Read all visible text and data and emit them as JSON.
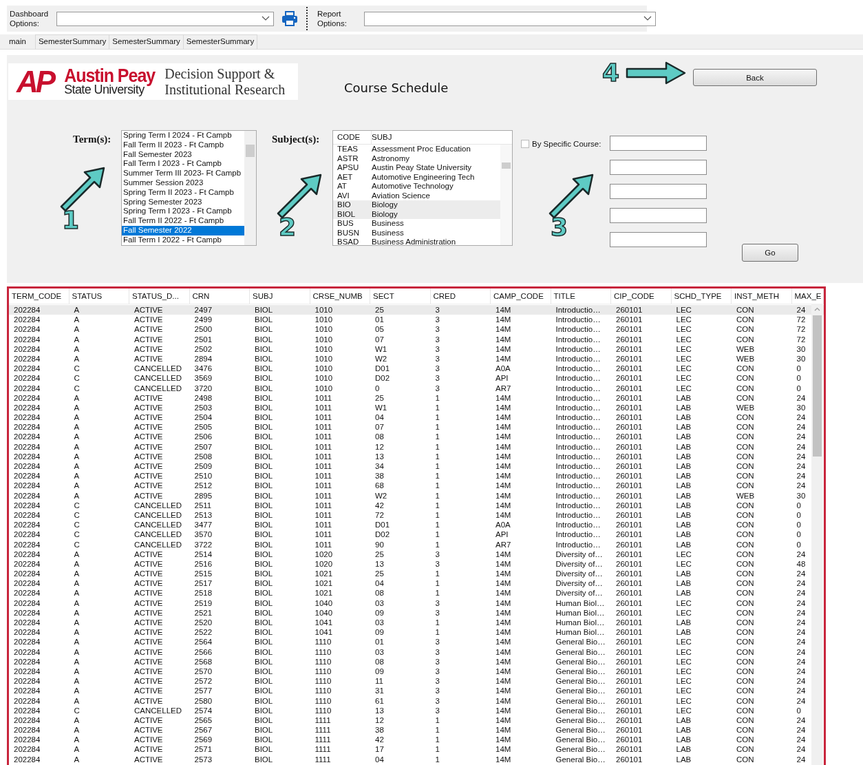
{
  "toolbar": {
    "dashboard_label": "Dashboard Options:",
    "report_label": "Report Options:"
  },
  "tabs": [
    {
      "label": "main",
      "selected": true
    },
    {
      "label": "SemesterSummary",
      "selected": false
    },
    {
      "label": "SemesterSummary",
      "selected": false
    },
    {
      "label": "SemesterSummary",
      "selected": false
    }
  ],
  "logo": {
    "monogram": "AP",
    "name_lines": [
      "Austin Peay",
      "State University"
    ],
    "department_lines": [
      "Decision Support &",
      "Institutional Research"
    ]
  },
  "title": "Course Schedule",
  "back_button": "Back",
  "terms": {
    "label": "Term(s):",
    "items": [
      {
        "text": "Spring Term I 2024 - Ft Campb",
        "selected": false
      },
      {
        "text": "Fall Term II 2023 - Ft Campb",
        "selected": false
      },
      {
        "text": "Fall Semester 2023",
        "selected": false
      },
      {
        "text": "Fall Term I 2023 - Ft Campb",
        "selected": false
      },
      {
        "text": "Summer Term III 2023- Ft Campb",
        "selected": false
      },
      {
        "text": "Summer Session 2023",
        "selected": false
      },
      {
        "text": "Spring Term II 2023 - Ft Campb",
        "selected": false
      },
      {
        "text": "Spring Semester 2023",
        "selected": false
      },
      {
        "text": "Spring Term I 2023 - Ft Campb",
        "selected": false
      },
      {
        "text": "Fall Term II 2022 - Ft Campb",
        "selected": false
      },
      {
        "text": "Fall Semester 2022",
        "selected": true
      },
      {
        "text": "Fall Term I 2022 - Ft Campb",
        "selected": false
      }
    ]
  },
  "subjects": {
    "label": "Subject(s):",
    "columns": [
      "CODE",
      "SUBJ"
    ],
    "items": [
      {
        "code": "TEAS",
        "subj": "Assessment Proc Education",
        "selected": false
      },
      {
        "code": "ASTR",
        "subj": "Astronomy",
        "selected": false
      },
      {
        "code": "APSU",
        "subj": "Austin Peay State University",
        "selected": false
      },
      {
        "code": "AET",
        "subj": "Automotive Engineering Tech",
        "selected": false
      },
      {
        "code": "AT",
        "subj": "Automotive Technology",
        "selected": false
      },
      {
        "code": "AVI",
        "subj": "Aviation Science",
        "selected": false
      },
      {
        "code": "BIO",
        "subj": "Biology",
        "selected": true
      },
      {
        "code": "BIOL",
        "subj": "Biology",
        "selected": true
      },
      {
        "code": "BUS",
        "subj": "Business",
        "selected": false
      },
      {
        "code": "BUSN",
        "subj": "Business",
        "selected": false
      },
      {
        "code": "BSAD",
        "subj": "Business Administration",
        "selected": false
      }
    ]
  },
  "specific_course": {
    "label": "By Specific Course:",
    "checked": false
  },
  "go_button": "Go",
  "annotations": [
    {
      "label": "1",
      "kind": "diagonal"
    },
    {
      "label": "2",
      "kind": "diagonal"
    },
    {
      "label": "3",
      "kind": "diagonal"
    },
    {
      "label": "4",
      "kind": "horizontal"
    }
  ],
  "table": {
    "columns": [
      "TERM_CODE",
      "STATUS",
      "STATUS_D...",
      "CRN",
      "SUBJ",
      "CRSE_NUMB",
      "SECT",
      "CRED",
      "CAMP_CODE",
      "TITLE",
      "CIP_CODE",
      "SCHD_TYPE",
      "INST_METH",
      "MAX_E"
    ],
    "rows": [
      {
        "selected": true,
        "cells": [
          "202284",
          "A",
          "ACTIVE",
          "2497",
          "BIOL",
          "1010",
          "25",
          "3",
          "14M",
          "Introductio…",
          "260101",
          "LEC",
          "CON",
          "24"
        ]
      },
      {
        "selected": false,
        "cells": [
          "202284",
          "A",
          "ACTIVE",
          "2499",
          "BIOL",
          "1010",
          "01",
          "3",
          "14M",
          "Introductio…",
          "260101",
          "LEC",
          "CON",
          "72"
        ]
      },
      {
        "selected": false,
        "cells": [
          "202284",
          "A",
          "ACTIVE",
          "2500",
          "BIOL",
          "1010",
          "05",
          "3",
          "14M",
          "Introductio…",
          "260101",
          "LEC",
          "CON",
          "72"
        ]
      },
      {
        "selected": false,
        "cells": [
          "202284",
          "A",
          "ACTIVE",
          "2501",
          "BIOL",
          "1010",
          "07",
          "3",
          "14M",
          "Introductio…",
          "260101",
          "LEC",
          "CON",
          "72"
        ]
      },
      {
        "selected": false,
        "cells": [
          "202284",
          "A",
          "ACTIVE",
          "2502",
          "BIOL",
          "1010",
          "W1",
          "3",
          "14M",
          "Introductio…",
          "260101",
          "LEC",
          "WEB",
          "30"
        ]
      },
      {
        "selected": false,
        "cells": [
          "202284",
          "A",
          "ACTIVE",
          "2894",
          "BIOL",
          "1010",
          "W2",
          "3",
          "14M",
          "Introductio…",
          "260101",
          "LEC",
          "WEB",
          "30"
        ]
      },
      {
        "selected": false,
        "cells": [
          "202284",
          "C",
          "CANCELLED",
          "3476",
          "BIOL",
          "1010",
          "D01",
          "3",
          "A0A",
          "Introductio…",
          "260101",
          "LEC",
          "CON",
          "0"
        ]
      },
      {
        "selected": false,
        "cells": [
          "202284",
          "C",
          "CANCELLED",
          "3569",
          "BIOL",
          "1010",
          "D02",
          "3",
          "API",
          "Introductio…",
          "260101",
          "LEC",
          "CON",
          "0"
        ]
      },
      {
        "selected": false,
        "cells": [
          "202284",
          "C",
          "CANCELLED",
          "3720",
          "BIOL",
          "1010",
          "0",
          "3",
          "AR7",
          "Introductio…",
          "260101",
          "LEC",
          "CON",
          "0"
        ]
      },
      {
        "selected": false,
        "cells": [
          "202284",
          "A",
          "ACTIVE",
          "2498",
          "BIOL",
          "1011",
          "25",
          "1",
          "14M",
          "Introductio…",
          "260101",
          "LAB",
          "CON",
          "24"
        ]
      },
      {
        "selected": false,
        "cells": [
          "202284",
          "A",
          "ACTIVE",
          "2503",
          "BIOL",
          "1011",
          "W1",
          "1",
          "14M",
          "Introductio…",
          "260101",
          "LAB",
          "WEB",
          "30"
        ]
      },
      {
        "selected": false,
        "cells": [
          "202284",
          "A",
          "ACTIVE",
          "2504",
          "BIOL",
          "1011",
          "04",
          "1",
          "14M",
          "Introductio…",
          "260101",
          "LAB",
          "CON",
          "24"
        ]
      },
      {
        "selected": false,
        "cells": [
          "202284",
          "A",
          "ACTIVE",
          "2505",
          "BIOL",
          "1011",
          "07",
          "1",
          "14M",
          "Introductio…",
          "260101",
          "LAB",
          "CON",
          "24"
        ]
      },
      {
        "selected": false,
        "cells": [
          "202284",
          "A",
          "ACTIVE",
          "2506",
          "BIOL",
          "1011",
          "08",
          "1",
          "14M",
          "Introductio…",
          "260101",
          "LAB",
          "CON",
          "24"
        ]
      },
      {
        "selected": false,
        "cells": [
          "202284",
          "A",
          "ACTIVE",
          "2507",
          "BIOL",
          "1011",
          "12",
          "1",
          "14M",
          "Introductio…",
          "260101",
          "LAB",
          "CON",
          "24"
        ]
      },
      {
        "selected": false,
        "cells": [
          "202284",
          "A",
          "ACTIVE",
          "2508",
          "BIOL",
          "1011",
          "13",
          "1",
          "14M",
          "Introductio…",
          "260101",
          "LAB",
          "CON",
          "24"
        ]
      },
      {
        "selected": false,
        "cells": [
          "202284",
          "A",
          "ACTIVE",
          "2509",
          "BIOL",
          "1011",
          "34",
          "1",
          "14M",
          "Introductio…",
          "260101",
          "LAB",
          "CON",
          "24"
        ]
      },
      {
        "selected": false,
        "cells": [
          "202284",
          "A",
          "ACTIVE",
          "2510",
          "BIOL",
          "1011",
          "38",
          "1",
          "14M",
          "Introductio…",
          "260101",
          "LAB",
          "CON",
          "24"
        ]
      },
      {
        "selected": false,
        "cells": [
          "202284",
          "A",
          "ACTIVE",
          "2512",
          "BIOL",
          "1011",
          "68",
          "1",
          "14M",
          "Introductio…",
          "260101",
          "LAB",
          "CON",
          "24"
        ]
      },
      {
        "selected": false,
        "cells": [
          "202284",
          "A",
          "ACTIVE",
          "2895",
          "BIOL",
          "1011",
          "W2",
          "1",
          "14M",
          "Introductio…",
          "260101",
          "LAB",
          "WEB",
          "30"
        ]
      },
      {
        "selected": false,
        "cells": [
          "202284",
          "C",
          "CANCELLED",
          "2511",
          "BIOL",
          "1011",
          "42",
          "1",
          "14M",
          "Introductio…",
          "260101",
          "LAB",
          "CON",
          "0"
        ]
      },
      {
        "selected": false,
        "cells": [
          "202284",
          "C",
          "CANCELLED",
          "2513",
          "BIOL",
          "1011",
          "72",
          "1",
          "14M",
          "Introductio…",
          "260101",
          "LAB",
          "CON",
          "0"
        ]
      },
      {
        "selected": false,
        "cells": [
          "202284",
          "C",
          "CANCELLED",
          "3477",
          "BIOL",
          "1011",
          "D01",
          "1",
          "A0A",
          "Introductio…",
          "260101",
          "LAB",
          "CON",
          "0"
        ]
      },
      {
        "selected": false,
        "cells": [
          "202284",
          "C",
          "CANCELLED",
          "3570",
          "BIOL",
          "1011",
          "D02",
          "1",
          "API",
          "Introductio…",
          "260101",
          "LAB",
          "CON",
          "0"
        ]
      },
      {
        "selected": false,
        "cells": [
          "202284",
          "C",
          "CANCELLED",
          "3722",
          "BIOL",
          "1011",
          "90",
          "1",
          "AR7",
          "Introductio…",
          "260101",
          "LAB",
          "CON",
          "0"
        ]
      },
      {
        "selected": false,
        "cells": [
          "202284",
          "A",
          "ACTIVE",
          "2514",
          "BIOL",
          "1020",
          "25",
          "3",
          "14M",
          "Diversity of…",
          "260101",
          "LEC",
          "CON",
          "24"
        ]
      },
      {
        "selected": false,
        "cells": [
          "202284",
          "A",
          "ACTIVE",
          "2516",
          "BIOL",
          "1020",
          "13",
          "3",
          "14M",
          "Diversity of…",
          "260101",
          "LEC",
          "CON",
          "48"
        ]
      },
      {
        "selected": false,
        "cells": [
          "202284",
          "A",
          "ACTIVE",
          "2515",
          "BIOL",
          "1021",
          "25",
          "1",
          "14M",
          "Diversity of…",
          "260101",
          "LAB",
          "CON",
          "24"
        ]
      },
      {
        "selected": false,
        "cells": [
          "202284",
          "A",
          "ACTIVE",
          "2517",
          "BIOL",
          "1021",
          "04",
          "1",
          "14M",
          "Diversity of…",
          "260101",
          "LAB",
          "CON",
          "24"
        ]
      },
      {
        "selected": false,
        "cells": [
          "202284",
          "A",
          "ACTIVE",
          "2518",
          "BIOL",
          "1021",
          "08",
          "1",
          "14M",
          "Diversity of…",
          "260101",
          "LAB",
          "CON",
          "24"
        ]
      },
      {
        "selected": false,
        "cells": [
          "202284",
          "A",
          "ACTIVE",
          "2519",
          "BIOL",
          "1040",
          "03",
          "3",
          "14M",
          "Human Biol…",
          "260101",
          "LEC",
          "CON",
          "24"
        ]
      },
      {
        "selected": false,
        "cells": [
          "202284",
          "A",
          "ACTIVE",
          "2521",
          "BIOL",
          "1040",
          "09",
          "3",
          "14M",
          "Human Biol…",
          "260101",
          "LEC",
          "CON",
          "24"
        ]
      },
      {
        "selected": false,
        "cells": [
          "202284",
          "A",
          "ACTIVE",
          "2520",
          "BIOL",
          "1041",
          "03",
          "1",
          "14M",
          "Human Biol…",
          "260101",
          "LAB",
          "CON",
          "24"
        ]
      },
      {
        "selected": false,
        "cells": [
          "202284",
          "A",
          "ACTIVE",
          "2522",
          "BIOL",
          "1041",
          "09",
          "1",
          "14M",
          "Human Biol…",
          "260101",
          "LAB",
          "CON",
          "24"
        ]
      },
      {
        "selected": false,
        "cells": [
          "202284",
          "A",
          "ACTIVE",
          "2564",
          "BIOL",
          "1110",
          "01",
          "3",
          "14M",
          "General Bio…",
          "260101",
          "LEC",
          "CON",
          "24"
        ]
      },
      {
        "selected": false,
        "cells": [
          "202284",
          "A",
          "ACTIVE",
          "2566",
          "BIOL",
          "1110",
          "03",
          "3",
          "14M",
          "General Bio…",
          "260101",
          "LEC",
          "CON",
          "24"
        ]
      },
      {
        "selected": false,
        "cells": [
          "202284",
          "A",
          "ACTIVE",
          "2568",
          "BIOL",
          "1110",
          "08",
          "3",
          "14M",
          "General Bio…",
          "260101",
          "LEC",
          "CON",
          "24"
        ]
      },
      {
        "selected": false,
        "cells": [
          "202284",
          "A",
          "ACTIVE",
          "2570",
          "BIOL",
          "1110",
          "09",
          "3",
          "14M",
          "General Bio…",
          "260101",
          "LEC",
          "CON",
          "24"
        ]
      },
      {
        "selected": false,
        "cells": [
          "202284",
          "A",
          "ACTIVE",
          "2572",
          "BIOL",
          "1110",
          "11",
          "3",
          "14M",
          "General Bio…",
          "260101",
          "LEC",
          "CON",
          "24"
        ]
      },
      {
        "selected": false,
        "cells": [
          "202284",
          "A",
          "ACTIVE",
          "2577",
          "BIOL",
          "1110",
          "31",
          "3",
          "14M",
          "General Bio…",
          "260101",
          "LEC",
          "CON",
          "24"
        ]
      },
      {
        "selected": false,
        "cells": [
          "202284",
          "A",
          "ACTIVE",
          "2580",
          "BIOL",
          "1110",
          "61",
          "3",
          "14M",
          "General Bio…",
          "260101",
          "LEC",
          "CON",
          "24"
        ]
      },
      {
        "selected": false,
        "cells": [
          "202284",
          "C",
          "CANCELLED",
          "2574",
          "BIOL",
          "1110",
          "13",
          "3",
          "14M",
          "General Bio…",
          "260101",
          "LEC",
          "CON",
          "0"
        ]
      },
      {
        "selected": false,
        "cells": [
          "202284",
          "A",
          "ACTIVE",
          "2565",
          "BIOL",
          "1111",
          "12",
          "1",
          "14M",
          "General Bio…",
          "260101",
          "LAB",
          "CON",
          "24"
        ]
      },
      {
        "selected": false,
        "cells": [
          "202284",
          "A",
          "ACTIVE",
          "2567",
          "BIOL",
          "1111",
          "38",
          "1",
          "14M",
          "General Bio…",
          "260101",
          "LAB",
          "CON",
          "24"
        ]
      },
      {
        "selected": false,
        "cells": [
          "202284",
          "A",
          "ACTIVE",
          "2569",
          "BIOL",
          "1111",
          "42",
          "1",
          "14M",
          "General Bio…",
          "260101",
          "LAB",
          "CON",
          "24"
        ]
      },
      {
        "selected": false,
        "cells": [
          "202284",
          "A",
          "ACTIVE",
          "2571",
          "BIOL",
          "1111",
          "17",
          "1",
          "14M",
          "General Bio…",
          "260101",
          "LAB",
          "CON",
          "24"
        ]
      },
      {
        "selected": false,
        "cells": [
          "202284",
          "A",
          "ACTIVE",
          "2573",
          "BIOL",
          "1111",
          "04",
          "1",
          "14M",
          "General Bio…",
          "260101",
          "LAB",
          "CON",
          "24"
        ]
      }
    ]
  }
}
